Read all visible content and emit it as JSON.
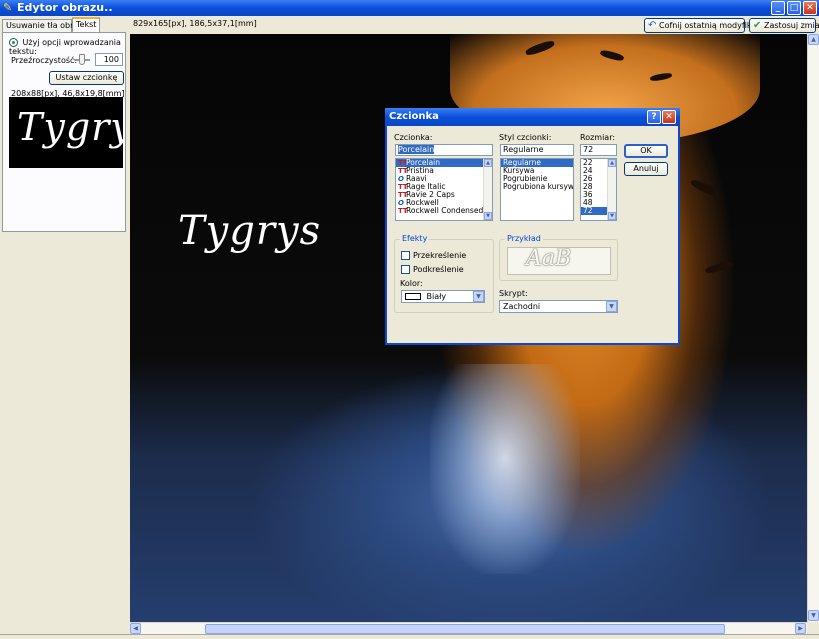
{
  "window": {
    "title": "Edytor obrazu..",
    "minimize": "_",
    "maximize": "□",
    "close": "✕"
  },
  "left_panel": {
    "tabs": [
      "Usuwanie tła obrazu",
      "Tekst"
    ],
    "active_tab": "Tekst",
    "radio_label": "Użyj opcji wprowadzania tekstu:",
    "opacity_label": "Przeźroczystość:",
    "opacity_value": "100",
    "opacity_level": 1.0,
    "set_font_button": "Ustaw czcionkę",
    "dims": "208x88[px], 46,8x19,8[mm]",
    "preview_text": "Tygrys"
  },
  "toolbar": {
    "coords": "829x165[px], 186,5x37,1[mm]",
    "undo_button": "Cofnij ostatnią modyfikację",
    "apply_button": "Zastosuj zmiany"
  },
  "canvas": {
    "overlay_text": "Tygrys"
  },
  "font_dialog": {
    "title": "Czcionka",
    "help_button": "?",
    "close_button": "✕",
    "font_label": "Czcionka:",
    "font_value": "Porcelain",
    "font_list": [
      {
        "name": "Porcelain",
        "icon": "TT",
        "selected": true
      },
      {
        "name": "Pristina",
        "icon": "TT",
        "selected": false
      },
      {
        "name": "Raavi",
        "icon": "O",
        "selected": false
      },
      {
        "name": "Rage Italic",
        "icon": "TT",
        "selected": false
      },
      {
        "name": "Ravie 2 Caps",
        "icon": "TT",
        "selected": false
      },
      {
        "name": "Rockwell",
        "icon": "O",
        "selected": false
      },
      {
        "name": "Rockwell Condensed",
        "icon": "TT",
        "selected": false
      }
    ],
    "style_label": "Styl czcionki:",
    "style_value": "Regularne",
    "style_list": [
      {
        "name": "Regularne",
        "selected": true
      },
      {
        "name": "Kursywa",
        "selected": false
      },
      {
        "name": "Pogrubienie",
        "selected": false
      },
      {
        "name": "Pogrubiona kursywa",
        "selected": false
      }
    ],
    "size_label": "Rozmiar:",
    "size_value": "72",
    "size_list": [
      {
        "name": "22",
        "selected": false
      },
      {
        "name": "24",
        "selected": false
      },
      {
        "name": "26",
        "selected": false
      },
      {
        "name": "28",
        "selected": false
      },
      {
        "name": "36",
        "selected": false
      },
      {
        "name": "48",
        "selected": false
      },
      {
        "name": "72",
        "selected": true
      }
    ],
    "ok_button": "OK",
    "cancel_button": "Anuluj",
    "effects_label": "Efekty",
    "strikeout_label": "Przekreślenie",
    "underline_label": "Podkreślenie",
    "color_label": "Kolor:",
    "color_value": "Biały",
    "sample_label": "Przykład",
    "sample_text": "AaB",
    "script_label": "Skrypt:",
    "script_value": "Zachodni"
  },
  "colors": {
    "titlebar": "#0a4fd8",
    "selection": "#316ac5",
    "group_label": "#0046d5"
  }
}
